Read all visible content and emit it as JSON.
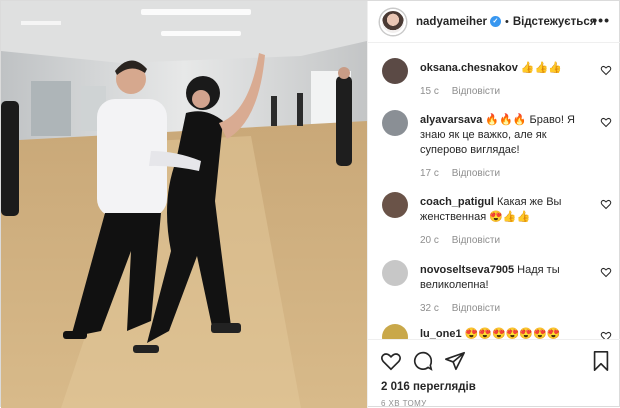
{
  "header": {
    "username": "nadyameiher",
    "separator": "•",
    "follow_label": "Відстежується",
    "more_label": "•••",
    "verified_label": "✓"
  },
  "comments": [
    {
      "user": "oksana.chesnakov",
      "text": "👍👍👍",
      "time": "15 с",
      "reply": "Відповісти",
      "avatar_color": "#5b4a45"
    },
    {
      "user": "alyavarsava",
      "text": "🔥🔥🔥 Браво! Я знаю як це важко, але як суперово виглядає!",
      "time": "17 с",
      "reply": "Відповісти",
      "avatar_color": "#8a8f95"
    },
    {
      "user": "coach_patigul",
      "text": "Какая же Вы женственная 😍👍👍",
      "time": "20 с",
      "reply": "Відповісти",
      "avatar_color": "#6a5348"
    },
    {
      "user": "novoseltseva7905",
      "text": "Надя ты великолепна!",
      "time": "32 с",
      "reply": "Відповісти",
      "avatar_color": "#c7c7c7"
    },
    {
      "user": "lu_one1",
      "text": "😍😍😍😍😍😍😍",
      "time": "",
      "reply": "",
      "avatar_color": "#c9a84a"
    }
  ],
  "footer": {
    "views": "2 016 переглядів",
    "posted": "6 ХВ ТОМУ"
  },
  "colors": {
    "link": "#262626",
    "muted": "#8e8e8e",
    "verified": "#3897f0",
    "border": "#efefef"
  },
  "icons": [
    "like-heart-icon",
    "comment-bubble-icon",
    "share-plane-icon",
    "bookmark-icon",
    "comment-like-heart-icon",
    "verified-badge-icon",
    "more-options-icon"
  ]
}
